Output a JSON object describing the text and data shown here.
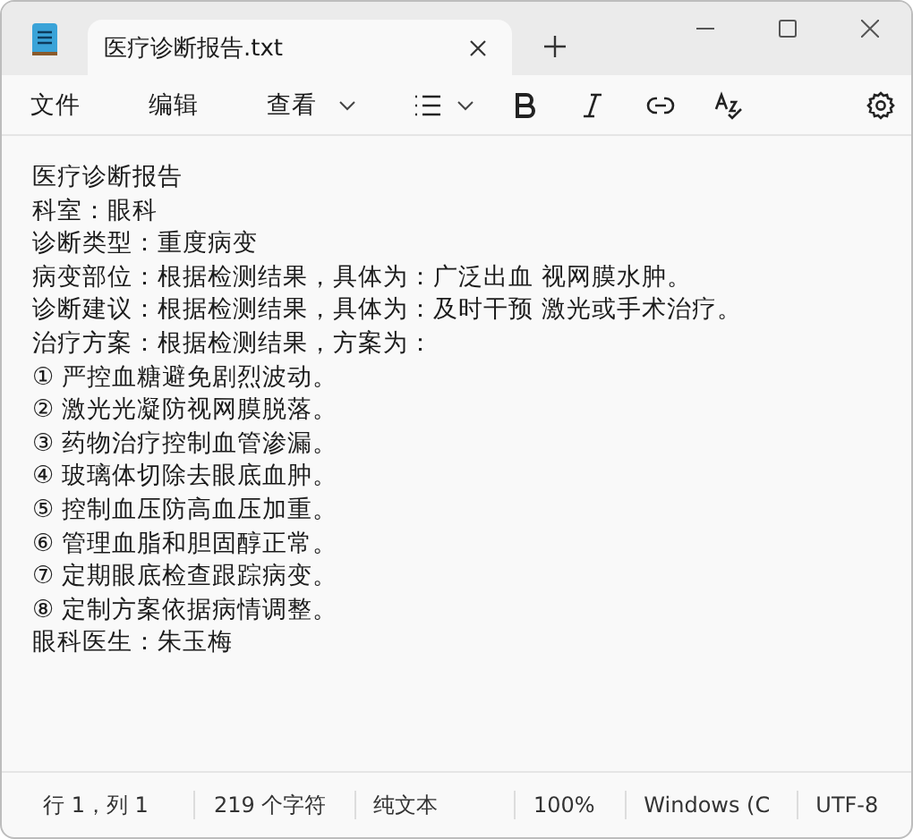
{
  "tab": {
    "title": "医疗诊断报告.txt",
    "selected": true
  },
  "menu": [
    "文件",
    "编辑",
    "查看"
  ],
  "document": {
    "lines": [
      "医疗诊断报告",
      "科室：眼科",
      "诊断类型：重度病变",
      "病变部位：根据检测结果，具体为：广泛出血 视网膜水肿。",
      "诊断建议：根据检测结果，具体为：及时干预 激光或手术治疗。",
      "治疗方案：根据检测结果，方案为：",
      "① 严控血糖避免剧烈波动。",
      "② 激光光凝防视网膜脱落。",
      "③ 药物治疗控制血管渗漏。",
      "④ 玻璃体切除去眼底血肿。",
      "⑤ 控制血压防高血压加重。",
      "⑥ 管理血脂和胆固醇正常。",
      "⑦ 定期眼底检查跟踪病变。",
      "⑧ 定制方案依据病情调整。",
      "眼科医生：朱玉梅"
    ]
  },
  "status_bar": [
    "行 1，列 1",
    "219 个字符",
    "纯文本",
    "100%",
    "Windows (C",
    "UTF-8"
  ]
}
